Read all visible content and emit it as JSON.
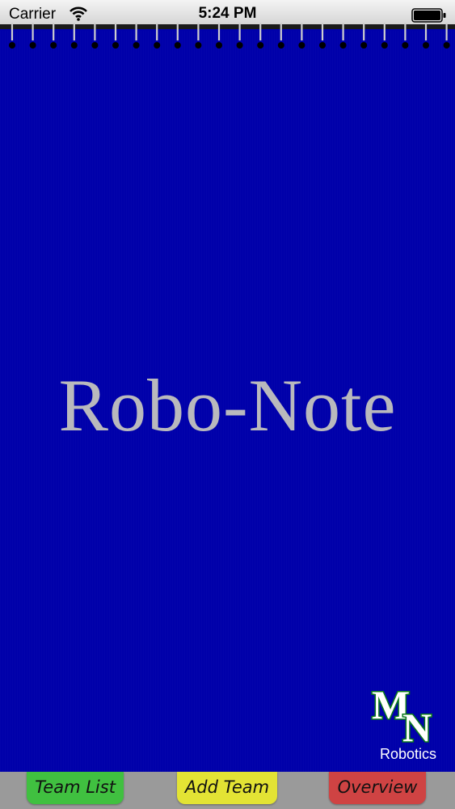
{
  "status_bar": {
    "carrier": "Carrier",
    "time": "5:24 PM",
    "wifi_icon": "wifi-icon",
    "battery_icon": "battery-icon"
  },
  "cover": {
    "title": "Robo-Note",
    "background_color": "#0000aa",
    "title_color": "#b9b9bd"
  },
  "logo": {
    "letters": "MN",
    "caption": "Robotics"
  },
  "tabs": [
    {
      "label": "Team List",
      "color": "#40c040"
    },
    {
      "label": "Add Team",
      "color": "#e3e334"
    },
    {
      "label": "Overview",
      "color": "#cf4343"
    }
  ]
}
